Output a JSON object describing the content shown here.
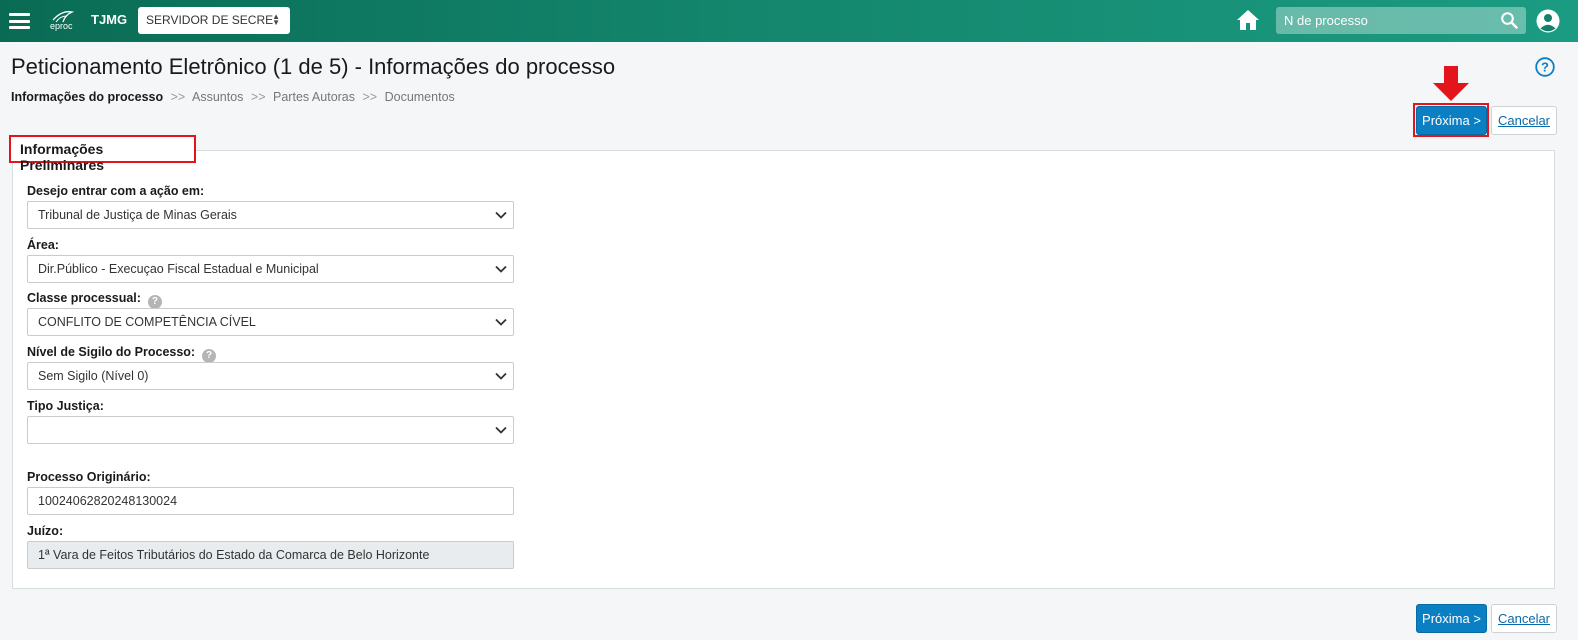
{
  "header": {
    "logo_text": "eproc",
    "org": "TJMG",
    "server_select": "SERVIDOR DE SECRE",
    "search_placeholder": "N de processo"
  },
  "page": {
    "title": "Peticionamento Eletrônico (1 de 5) - Informações do processo",
    "breadcrumb": {
      "active": "Informações do processo",
      "separator": ">>",
      "steps": [
        "Assuntos",
        "Partes Autoras",
        "Documentos"
      ]
    }
  },
  "actions": {
    "next_label": "Próxima >",
    "cancel_label": "Cancelar"
  },
  "form": {
    "legend": "Informações Preliminares",
    "fields": [
      {
        "label": "Desejo entrar com a ação em:",
        "value": "Tribunal de Justiça de Minas Gerais",
        "type": "select",
        "help": false
      },
      {
        "label": "Área:",
        "value": "Dir.Público - Execuçao Fiscal Estadual e Municipal",
        "type": "select",
        "help": false
      },
      {
        "label": "Classe processual:",
        "value": "CONFLITO DE COMPETÊNCIA CÍVEL",
        "type": "select",
        "help": true
      },
      {
        "label": "Nível de Sigilo do Processo:",
        "value": "Sem Sigilo (Nível 0)",
        "type": "select",
        "help": true
      },
      {
        "label": "Tipo Justiça:",
        "value": "",
        "type": "select",
        "help": false
      },
      {
        "label": "Processo Originário:",
        "value": "10024062820248130024",
        "type": "text",
        "help": false
      },
      {
        "label": "Juízo:",
        "value": "1ª Vara de Feitos Tributários do Estado da Comarca de Belo Horizonte",
        "type": "readonly",
        "help": false
      }
    ]
  },
  "colors": {
    "header_start": "#0a6b54",
    "header_end": "#1b9c82",
    "primary_button": "#0a7fc4",
    "highlight": "#e3141c"
  }
}
